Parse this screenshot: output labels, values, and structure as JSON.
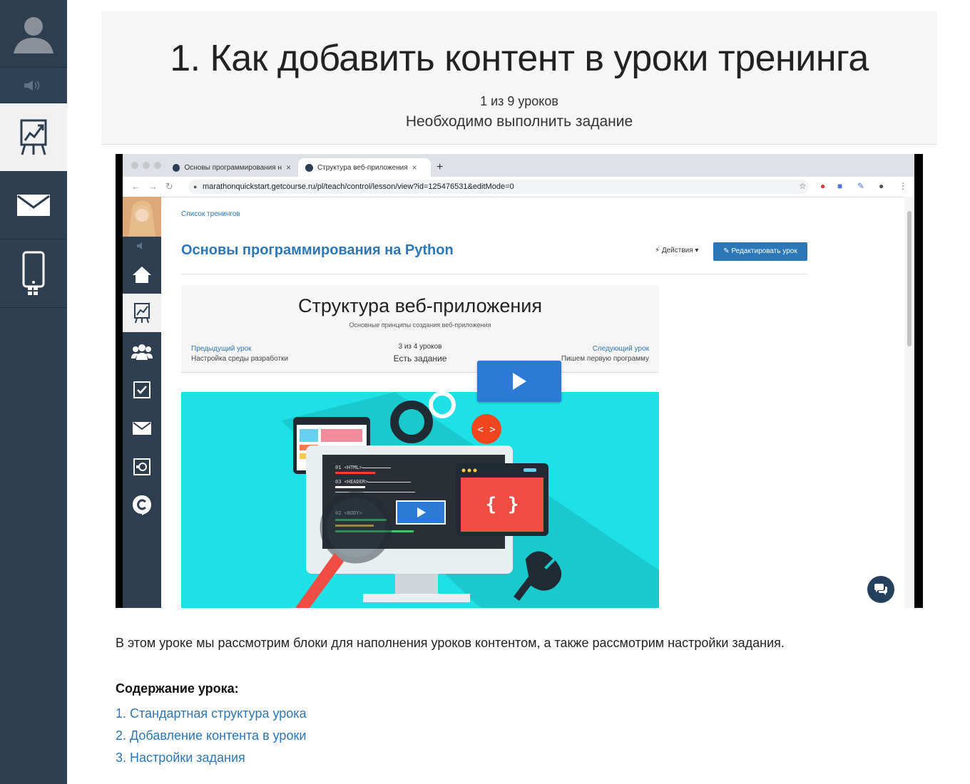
{
  "sidebar": {
    "items": [
      {
        "icon": "user-avatar-icon"
      },
      {
        "icon": "speaker-icon"
      },
      {
        "icon": "training-chart-icon",
        "active": true
      },
      {
        "icon": "mail-icon"
      },
      {
        "icon": "mobile-qr-icon"
      }
    ]
  },
  "header": {
    "title": "1. Как добавить контент в уроки тренинга",
    "lesson_count": "1 из 9 уроков",
    "task_status": "Необходимо выполнить задание"
  },
  "video": {
    "browser": {
      "tabs": [
        {
          "label": "Основы программирования н"
        },
        {
          "label": "Структура веб-приложения",
          "active": true
        }
      ],
      "url": "marathonquickstart.getcourse.ru/pl/teach/control/lesson/view?id=125476531&editMode=0"
    },
    "page": {
      "breadcrumb": "Список тренингов",
      "course_title": "Основы программирования на Python",
      "actions_label": "Действия",
      "edit_button": "Редактировать урок",
      "lesson_title": "Структура веб-приложения",
      "lesson_subtitle": "Основные принципы создания веб-приложения",
      "prev_label": "Предыдущий урок",
      "prev_title": "Настройка среды разработки",
      "count": "3 из 4 уроков",
      "task": "Есть задание",
      "next_label": "Следующий урок",
      "next_title": "Пишем первую программу"
    },
    "illustration": {
      "code_lines": [
        "01 <HTML>",
        "03 <HEADER>",
        "02 <BODY>"
      ],
      "braces": "{ }",
      "tag_icon": "< >"
    }
  },
  "description": "В этом уроке мы рассмотрим блоки для наполнения уроков контентом, а также рассмотрим настройки задания.",
  "toc": {
    "heading": "Содержание урока:",
    "items": [
      "1. Стандартная структура урока",
      "2. Добавление контента в уроки",
      "3. Настройки задания"
    ]
  },
  "colors": {
    "rail": "#2c3e50",
    "link": "#2b77b8",
    "play": "#2b7bd6",
    "hero": "#1de1e6"
  }
}
